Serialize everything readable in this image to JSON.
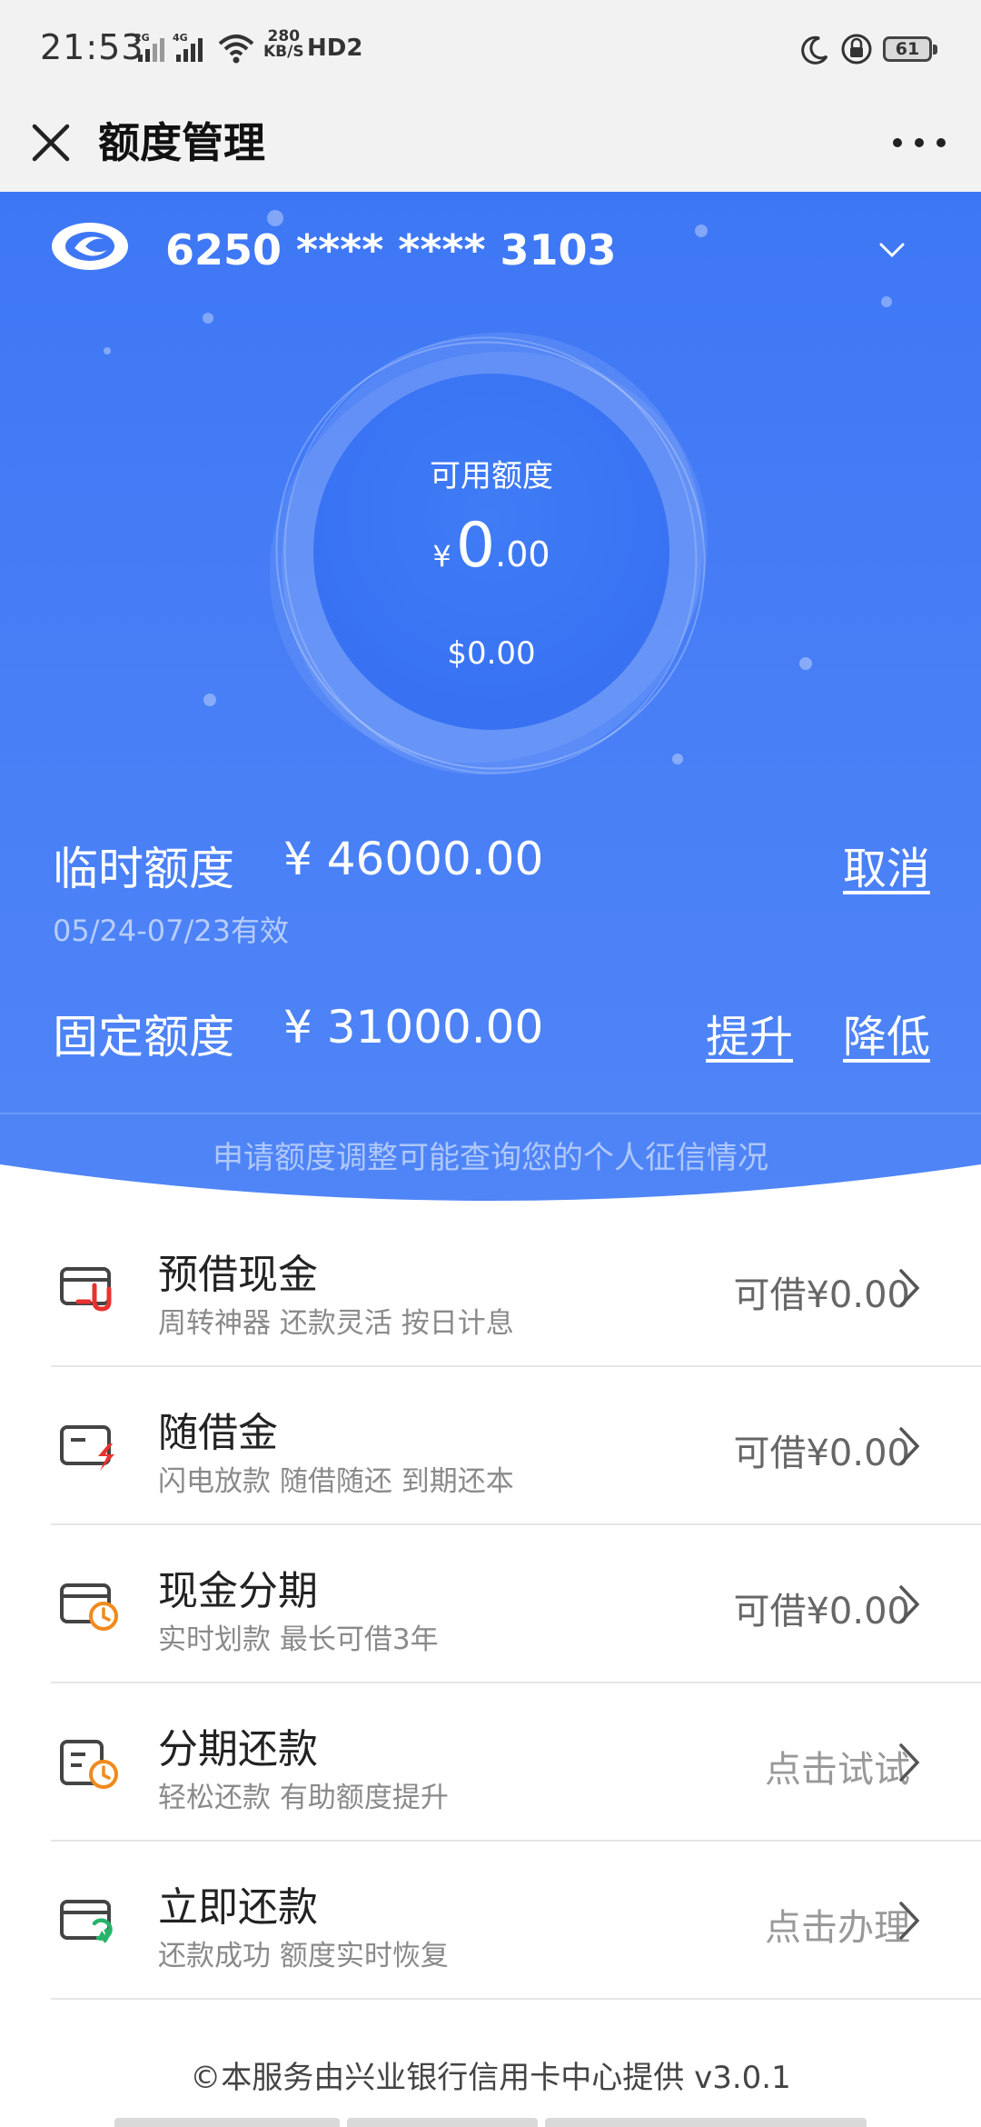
{
  "status_bar": {
    "time": "21:53",
    "net_speed_value": "280",
    "net_speed_unit": "KB/S",
    "hd_label": "HD2",
    "battery": "61",
    "sig1_label": "2G",
    "sig2_label": "4G"
  },
  "nav": {
    "title": "额度管理"
  },
  "card": {
    "number": "6250 **** **** 3103"
  },
  "available": {
    "label": "可用额度",
    "currency": "¥",
    "amount_int": "0",
    "amount_dec": ".00",
    "usd": "$0.00"
  },
  "temporary": {
    "label": "临时额度",
    "amount": "¥ 46000.00",
    "validity": "05/24-07/23有效",
    "cancel_label": "取消"
  },
  "fixed": {
    "label": "固定额度",
    "amount": "¥ 31000.00",
    "raise_label": "提升",
    "lower_label": "降低"
  },
  "notice": "申请额度调整可能查询您的个人征信情况",
  "services": [
    {
      "title": "预借现金",
      "subtitle": "周转神器 还款灵活 按日计息",
      "right": "可借¥0.00",
      "icon": "cash-advance-icon"
    },
    {
      "title": "随借金",
      "subtitle": "闪电放款 随借随还 到期还本",
      "right": "可借¥0.00",
      "icon": "flash-loan-icon"
    },
    {
      "title": "现金分期",
      "subtitle": "实时划款 最长可借3年",
      "right": "可借¥0.00",
      "icon": "cash-installment-icon"
    },
    {
      "title": "分期还款",
      "subtitle": "轻松还款 有助额度提升",
      "right": "点击试试",
      "icon": "installment-repay-icon"
    },
    {
      "title": "立即还款",
      "subtitle": "还款成功 额度实时恢复",
      "right": "点击办理",
      "icon": "repay-now-icon"
    }
  ],
  "footer": "©本服务由兴业银行信用卡中心提供 v3.0.1",
  "colors": {
    "primary_blue": "#3e77f5",
    "accent_red": "#e8322e",
    "accent_orange": "#f08a1c",
    "accent_green": "#27b46a"
  }
}
